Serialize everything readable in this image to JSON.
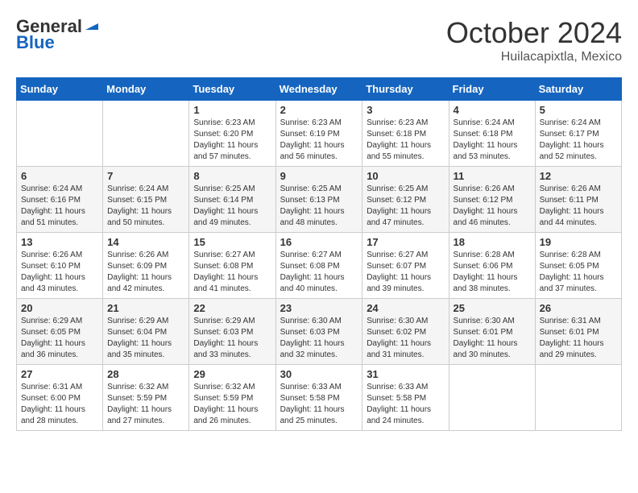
{
  "logo": {
    "general": "General",
    "blue": "Blue"
  },
  "title": "October 2024",
  "location": "Huilacapixtla, Mexico",
  "days_of_week": [
    "Sunday",
    "Monday",
    "Tuesday",
    "Wednesday",
    "Thursday",
    "Friday",
    "Saturday"
  ],
  "weeks": [
    [
      {
        "day": "",
        "info": ""
      },
      {
        "day": "",
        "info": ""
      },
      {
        "day": "1",
        "info": "Sunrise: 6:23 AM\nSunset: 6:20 PM\nDaylight: 11 hours and 57 minutes."
      },
      {
        "day": "2",
        "info": "Sunrise: 6:23 AM\nSunset: 6:19 PM\nDaylight: 11 hours and 56 minutes."
      },
      {
        "day": "3",
        "info": "Sunrise: 6:23 AM\nSunset: 6:18 PM\nDaylight: 11 hours and 55 minutes."
      },
      {
        "day": "4",
        "info": "Sunrise: 6:24 AM\nSunset: 6:18 PM\nDaylight: 11 hours and 53 minutes."
      },
      {
        "day": "5",
        "info": "Sunrise: 6:24 AM\nSunset: 6:17 PM\nDaylight: 11 hours and 52 minutes."
      }
    ],
    [
      {
        "day": "6",
        "info": "Sunrise: 6:24 AM\nSunset: 6:16 PM\nDaylight: 11 hours and 51 minutes."
      },
      {
        "day": "7",
        "info": "Sunrise: 6:24 AM\nSunset: 6:15 PM\nDaylight: 11 hours and 50 minutes."
      },
      {
        "day": "8",
        "info": "Sunrise: 6:25 AM\nSunset: 6:14 PM\nDaylight: 11 hours and 49 minutes."
      },
      {
        "day": "9",
        "info": "Sunrise: 6:25 AM\nSunset: 6:13 PM\nDaylight: 11 hours and 48 minutes."
      },
      {
        "day": "10",
        "info": "Sunrise: 6:25 AM\nSunset: 6:12 PM\nDaylight: 11 hours and 47 minutes."
      },
      {
        "day": "11",
        "info": "Sunrise: 6:26 AM\nSunset: 6:12 PM\nDaylight: 11 hours and 46 minutes."
      },
      {
        "day": "12",
        "info": "Sunrise: 6:26 AM\nSunset: 6:11 PM\nDaylight: 11 hours and 44 minutes."
      }
    ],
    [
      {
        "day": "13",
        "info": "Sunrise: 6:26 AM\nSunset: 6:10 PM\nDaylight: 11 hours and 43 minutes."
      },
      {
        "day": "14",
        "info": "Sunrise: 6:26 AM\nSunset: 6:09 PM\nDaylight: 11 hours and 42 minutes."
      },
      {
        "day": "15",
        "info": "Sunrise: 6:27 AM\nSunset: 6:08 PM\nDaylight: 11 hours and 41 minutes."
      },
      {
        "day": "16",
        "info": "Sunrise: 6:27 AM\nSunset: 6:08 PM\nDaylight: 11 hours and 40 minutes."
      },
      {
        "day": "17",
        "info": "Sunrise: 6:27 AM\nSunset: 6:07 PM\nDaylight: 11 hours and 39 minutes."
      },
      {
        "day": "18",
        "info": "Sunrise: 6:28 AM\nSunset: 6:06 PM\nDaylight: 11 hours and 38 minutes."
      },
      {
        "day": "19",
        "info": "Sunrise: 6:28 AM\nSunset: 6:05 PM\nDaylight: 11 hours and 37 minutes."
      }
    ],
    [
      {
        "day": "20",
        "info": "Sunrise: 6:29 AM\nSunset: 6:05 PM\nDaylight: 11 hours and 36 minutes."
      },
      {
        "day": "21",
        "info": "Sunrise: 6:29 AM\nSunset: 6:04 PM\nDaylight: 11 hours and 35 minutes."
      },
      {
        "day": "22",
        "info": "Sunrise: 6:29 AM\nSunset: 6:03 PM\nDaylight: 11 hours and 33 minutes."
      },
      {
        "day": "23",
        "info": "Sunrise: 6:30 AM\nSunset: 6:03 PM\nDaylight: 11 hours and 32 minutes."
      },
      {
        "day": "24",
        "info": "Sunrise: 6:30 AM\nSunset: 6:02 PM\nDaylight: 11 hours and 31 minutes."
      },
      {
        "day": "25",
        "info": "Sunrise: 6:30 AM\nSunset: 6:01 PM\nDaylight: 11 hours and 30 minutes."
      },
      {
        "day": "26",
        "info": "Sunrise: 6:31 AM\nSunset: 6:01 PM\nDaylight: 11 hours and 29 minutes."
      }
    ],
    [
      {
        "day": "27",
        "info": "Sunrise: 6:31 AM\nSunset: 6:00 PM\nDaylight: 11 hours and 28 minutes."
      },
      {
        "day": "28",
        "info": "Sunrise: 6:32 AM\nSunset: 5:59 PM\nDaylight: 11 hours and 27 minutes."
      },
      {
        "day": "29",
        "info": "Sunrise: 6:32 AM\nSunset: 5:59 PM\nDaylight: 11 hours and 26 minutes."
      },
      {
        "day": "30",
        "info": "Sunrise: 6:33 AM\nSunset: 5:58 PM\nDaylight: 11 hours and 25 minutes."
      },
      {
        "day": "31",
        "info": "Sunrise: 6:33 AM\nSunset: 5:58 PM\nDaylight: 11 hours and 24 minutes."
      },
      {
        "day": "",
        "info": ""
      },
      {
        "day": "",
        "info": ""
      }
    ]
  ]
}
